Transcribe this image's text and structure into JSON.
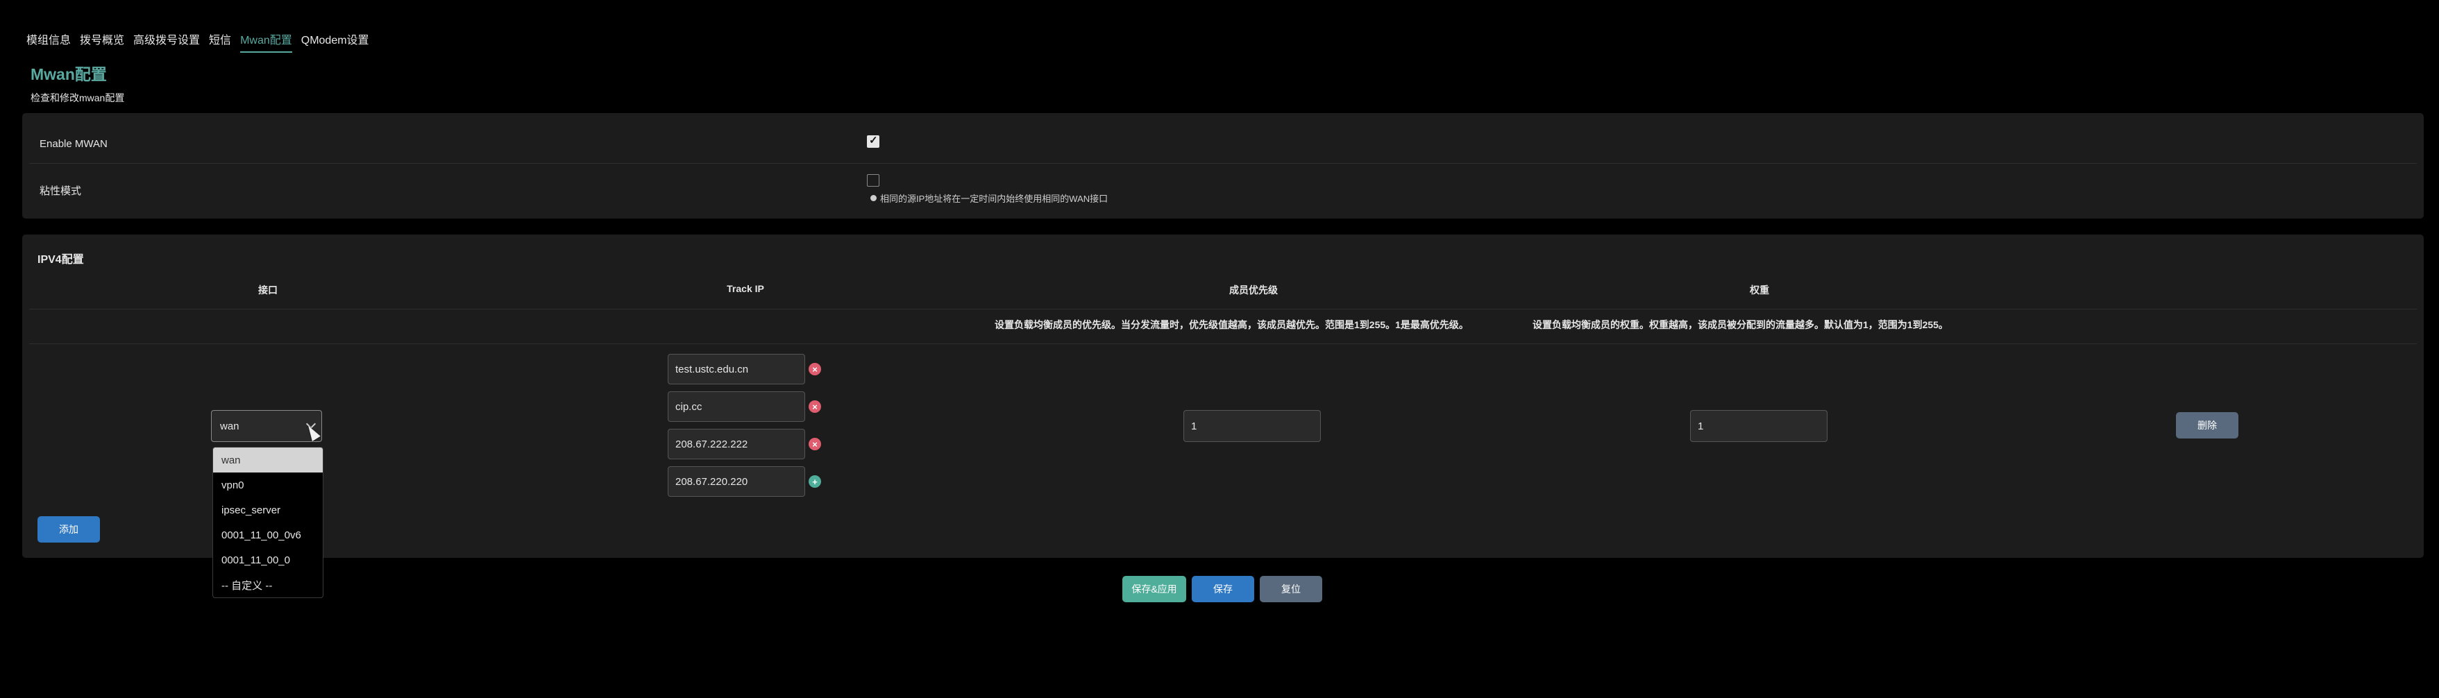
{
  "tabs": [
    "模组信息",
    "拨号概览",
    "高级拨号设置",
    "短信",
    "Mwan配置",
    "QModem设置"
  ],
  "active_tab": "Mwan配置",
  "page": {
    "title": "Mwan配置",
    "description": "检查和修改mwan配置"
  },
  "general": {
    "enable_mwan_label": "Enable MWAN",
    "enable_mwan_checked": true,
    "sticky_label": "粘性模式",
    "sticky_checked": false,
    "sticky_hint": "相同的源IP地址将在一定时间内始终使用相同的WAN接口"
  },
  "ipv4": {
    "title": "IPV4配置",
    "headers": {
      "interface": "接口",
      "track_ip": "Track IP",
      "priority": "成员优先级",
      "weight": "权重"
    },
    "priority_desc": "设置负载均衡成员的优先级。当分发流量时，优先级值越高，该成员越优先。范围是1到255。1是最高优先级。",
    "weight_desc": "设置负载均衡成员的权重。权重越高，该成员被分配到的流量越多。默认值为1，范围为1到255。",
    "row": {
      "interface": "wan",
      "track_ips": [
        "test.ustc.edu.cn",
        "cip.cc",
        "208.67.222.222",
        "208.67.220.220"
      ],
      "priority": "1",
      "weight": "1",
      "delete_label": "删除"
    },
    "add_label": "添加"
  },
  "dropdown": {
    "options": [
      "wan",
      "vpn0",
      "ipsec_server",
      "0001_11_00_0v6",
      "0001_11_00_0",
      "-- 自定义 --"
    ],
    "selected": "wan"
  },
  "actions": {
    "save_apply": "保存&应用",
    "save": "保存",
    "reset": "复位"
  },
  "colors": {
    "accent": "#5aa9a0",
    "primary": "#2f78c4",
    "neutral": "#5a6a7e",
    "remove": "#e05d6f",
    "add": "#4fae9a"
  }
}
